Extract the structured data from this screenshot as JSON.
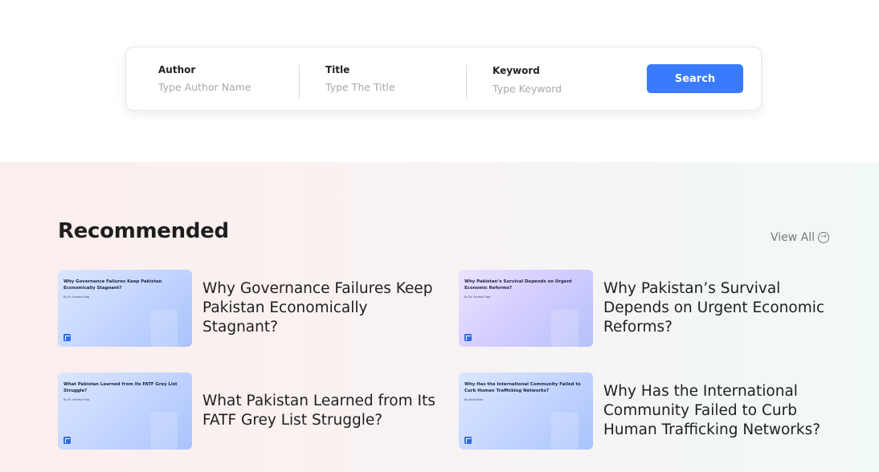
{
  "search": {
    "author": {
      "label": "Author",
      "placeholder": "Type Author Name"
    },
    "title": {
      "label": "Title",
      "placeholder": "Type The Title"
    },
    "keyword": {
      "label": "Keyword",
      "placeholder": "Type Keyword"
    },
    "button_label": "Search"
  },
  "recommended": {
    "heading": "Recommended",
    "view_all": "View All",
    "items": [
      {
        "headline": "Why Governance Failures Keep Pakistan Economically Stagnant?",
        "thumb_title": "Why Governance Failures Keep Pakistan Economically Stagnant?",
        "thumb_author": "By Dr. Ikramul Haq"
      },
      {
        "headline": "Why Pakistan’s Survival Depends on Urgent Economic Reforms?",
        "thumb_title": "Why Pakistan’s Survival Depends on Urgent Economic Reforms?",
        "thumb_author": "By Dr. Ikramul Haq"
      },
      {
        "headline": "What Pakistan Learned from Its FATF Grey List Struggle?",
        "thumb_title": "What Pakistan Learned from Its FATF Grey List Struggle?",
        "thumb_author": "By Dr. Ikramul Haq"
      },
      {
        "headline": "Why Has the International Community Failed to Curb Human Trafficking Networks?",
        "thumb_title": "Why Has the International Community Failed to Curb Human Trafficking Networks?",
        "thumb_author": "By Asad Ullah"
      }
    ]
  },
  "colors": {
    "accent": "#3a7bfd",
    "logo": "#2f6ce5"
  }
}
